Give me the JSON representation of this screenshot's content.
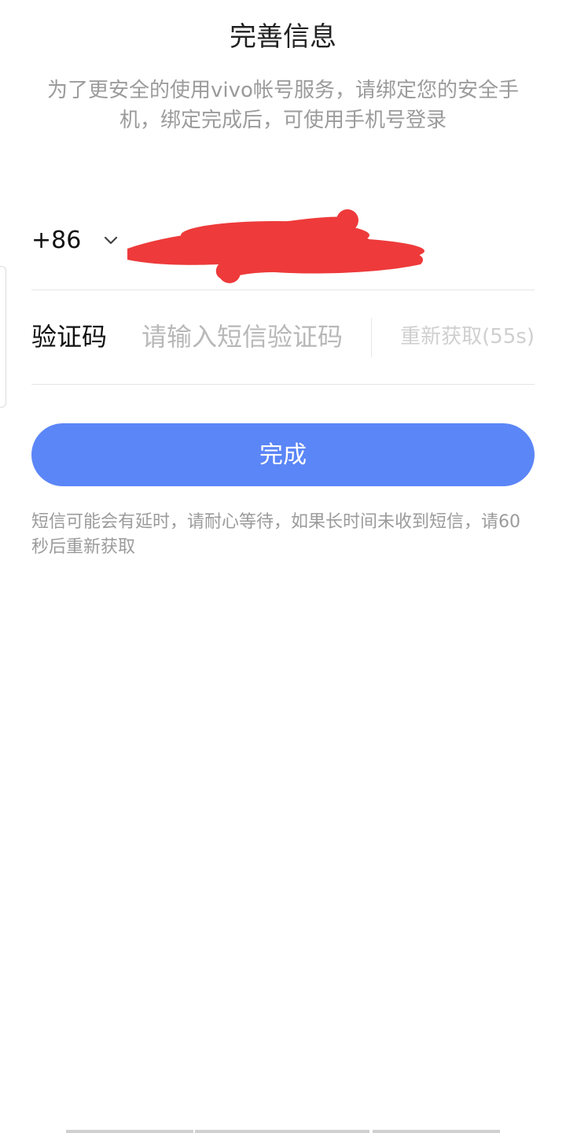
{
  "header": {
    "title": "完善信息",
    "subtitle": "为了更安全的使用vivo帐号服务，请绑定您的安全手机，绑定完成后，可使用手机号登录"
  },
  "phone": {
    "country_code": "+86"
  },
  "verification": {
    "label": "验证码",
    "placeholder": "请输入短信验证码",
    "resend_label": "重新获取(55s)"
  },
  "actions": {
    "done_label": "完成"
  },
  "hint": "短信可能会有延时，请耐心等待，如果长时间未收到短信，请60秒后重新获取",
  "colors": {
    "primary_button": "#5b86f7",
    "redaction": "#ee3a3a"
  }
}
